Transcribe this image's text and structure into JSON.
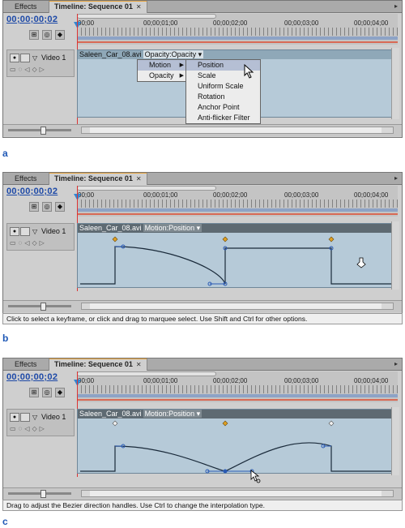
{
  "panels": [
    {
      "tabs": {
        "effects": "Effects",
        "timeline": "Timeline: Sequence 01",
        "close": "✕",
        "menu": "▸"
      },
      "timecode": "00;00;00;02",
      "ruler": [
        "00;00",
        "00;00;01;00",
        "00;00;02;00",
        "00;00;03;00",
        "00;00;04;00"
      ],
      "track": {
        "name": "Video 1"
      },
      "clip": {
        "name": "Saleen_Car_08.avi",
        "property": "Opacity:Opacity"
      },
      "caption": "a"
    },
    {
      "tabs": {
        "effects": "Effects",
        "timeline": "Timeline: Sequence 01",
        "close": "✕",
        "menu": "▸"
      },
      "timecode": "00;00;00;02",
      "ruler": [
        "00;00",
        "00;00;01;00",
        "00;00;02;00",
        "00;00;03;00",
        "00;00;04;00"
      ],
      "track": {
        "name": "Video 1"
      },
      "clip": {
        "name": "Saleen_Car_08.avi",
        "property": "Motion:Position"
      },
      "status": "Click to select a keyframe, or click and drag to marquee select. Use Shift and Ctrl for other options.",
      "caption": "b"
    },
    {
      "tabs": {
        "effects": "Effects",
        "timeline": "Timeline: Sequence 01",
        "close": "✕",
        "menu": "▸"
      },
      "timecode": "00;00;00;02",
      "ruler": [
        "00;00",
        "00;00;01;00",
        "00;00;02;00",
        "00;00;03;00",
        "00;00;04;00"
      ],
      "track": {
        "name": "Video 1"
      },
      "clip": {
        "name": "Saleen_Car_08.avi",
        "property": "Motion:Position"
      },
      "status": "Drag to adjust the Bezier direction handles. Use Ctrl to change the interpolation type.",
      "caption": "c"
    }
  ],
  "menu": {
    "main": [
      "Motion",
      "Opacity"
    ],
    "sub": [
      "Position",
      "Scale",
      "Uniform Scale",
      "Rotation",
      "Anchor Point",
      "Anti-flicker Filter"
    ],
    "highlighted": "Position"
  },
  "colors": {
    "timecode": "#1d49a7",
    "accent_tab": "#e8a33c",
    "clip": "#b6cad8",
    "caption": "#1f58b6"
  }
}
